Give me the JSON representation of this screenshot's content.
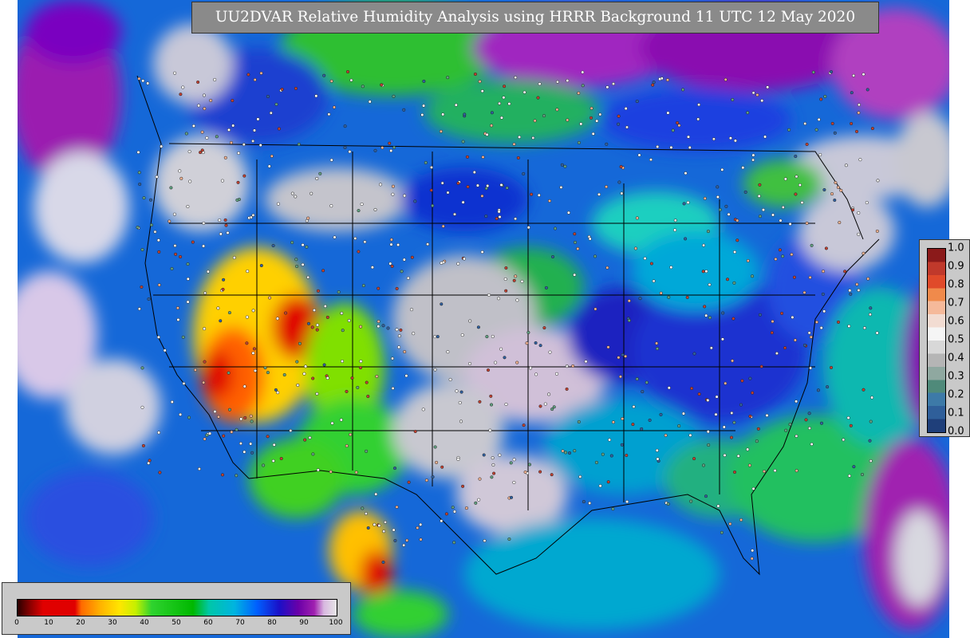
{
  "title": "UU2DVAR Relative Humidity Analysis using HRRR Background 11 UTC 12 May 2020",
  "humidity_colorbar": {
    "ticks": [
      "0",
      "10",
      "20",
      "30",
      "40",
      "50",
      "60",
      "70",
      "80",
      "90",
      "100"
    ],
    "stops": [
      {
        "v": 0,
        "c": "#2a0000"
      },
      {
        "v": 4,
        "c": "#8b0000"
      },
      {
        "v": 8,
        "c": "#e00000"
      },
      {
        "v": 18,
        "c": "#e00000"
      },
      {
        "v": 20,
        "c": "#ff6a00"
      },
      {
        "v": 26,
        "c": "#ffb300"
      },
      {
        "v": 32,
        "c": "#ffe600"
      },
      {
        "v": 37,
        "c": "#c6f000"
      },
      {
        "v": 42,
        "c": "#2fd32f"
      },
      {
        "v": 55,
        "c": "#00b800"
      },
      {
        "v": 60,
        "c": "#00c7a8"
      },
      {
        "v": 68,
        "c": "#00b4e0"
      },
      {
        "v": 75,
        "c": "#0060ff"
      },
      {
        "v": 82,
        "c": "#1a10c8"
      },
      {
        "v": 88,
        "c": "#6a00a8"
      },
      {
        "v": 93,
        "c": "#a020b0"
      },
      {
        "v": 96,
        "c": "#d8b8e0"
      },
      {
        "v": 100,
        "c": "#e6e6e6"
      }
    ]
  },
  "station_colorbar": {
    "ticks": [
      "1.0",
      "0.9",
      "0.8",
      "0.7",
      "0.6",
      "0.5",
      "0.4",
      "0.3",
      "0.2",
      "0.1",
      "0.0"
    ],
    "colors": [
      "#8b1a1a",
      "#c0392b",
      "#e04a2a",
      "#f08a4b",
      "#f5b99a",
      "#f2dcd2",
      "#f5f5f5",
      "#d8d8d8",
      "#b5b5b5",
      "#8fa8a0",
      "#4f8a7a",
      "#3d7aa8",
      "#2f5f9a",
      "#1f3f7a"
    ]
  },
  "colors": {
    "ocean": "#1a6fd8",
    "land_bg": "#b8b8b8",
    "state_lines": "#000000",
    "panel": "#c9c9c9",
    "title_bg": "#8a8a8a"
  }
}
